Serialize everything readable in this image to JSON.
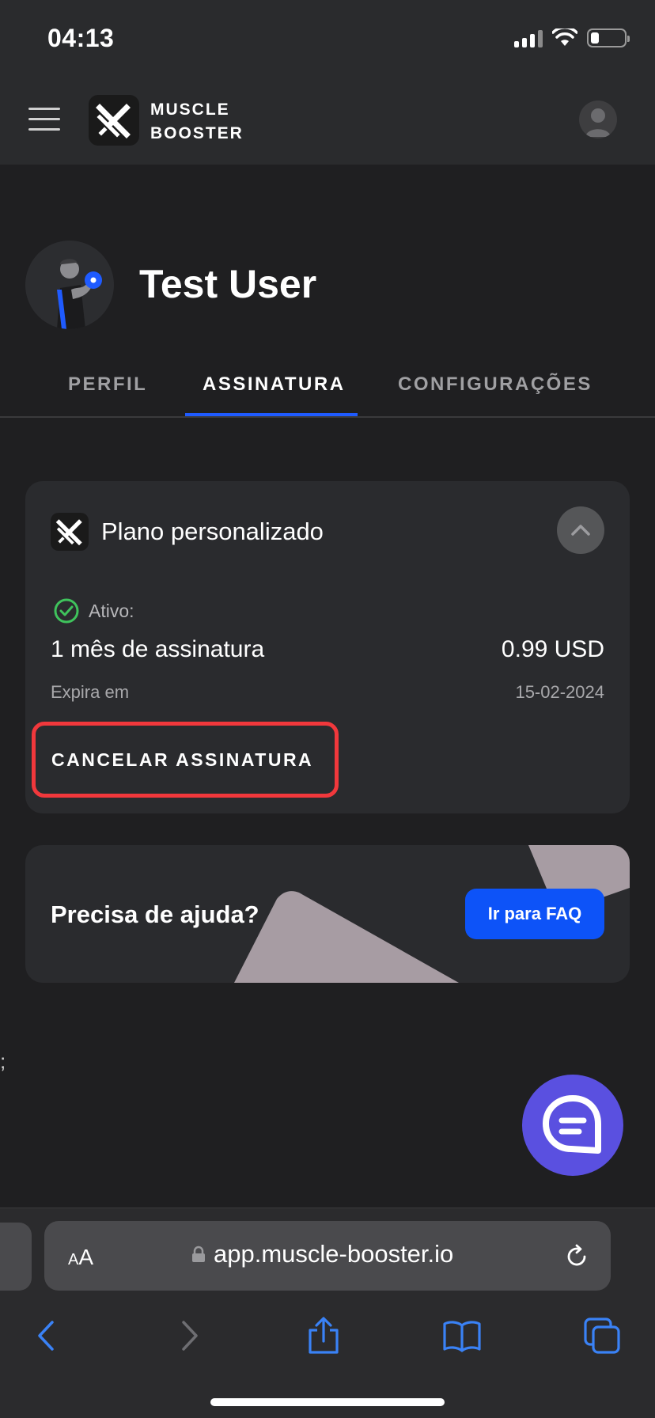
{
  "status_bar": {
    "time": "04:13"
  },
  "header": {
    "brand_line1": "MUSCLE",
    "brand_line2": "BOOSTER"
  },
  "profile": {
    "name": "Test User"
  },
  "tabs": [
    {
      "label": "PERFIL",
      "active": false
    },
    {
      "label": "ASSINATURA",
      "active": true
    },
    {
      "label": "CONFIGURAÇÕES",
      "active": false
    }
  ],
  "plan_card": {
    "title": "Plano personalizado",
    "status_label": "Ativo:",
    "subscription_name": "1 mês de assinatura",
    "price": "0.99 USD",
    "expires_label": "Expira em",
    "expires_date": "15-02-2024",
    "cancel_label": "CANCELAR ASSINATURA"
  },
  "help_card": {
    "title": "Precisa de ajuda?",
    "faq_button": "Ir para FAQ"
  },
  "stray_text": ";",
  "browser": {
    "text_size_label_small": "A",
    "text_size_label_large": "A",
    "url": "app.muscle-booster.io"
  },
  "colors": {
    "accent": "#1f5bff",
    "faq_button": "#0d53f8",
    "cancel_outline": "#f1383c",
    "status_ok": "#3fc35c",
    "chat_fab": "#5a50e0",
    "safari_icons": "#3a82f6"
  },
  "icons": [
    "hamburger-icon",
    "brand-logo-icon",
    "user-avatar-icon",
    "check-circle-icon",
    "chevron-up-icon",
    "chat-icon",
    "lock-icon",
    "reload-icon",
    "back-icon",
    "forward-icon",
    "share-icon",
    "bookmarks-icon",
    "tabs-icon"
  ]
}
